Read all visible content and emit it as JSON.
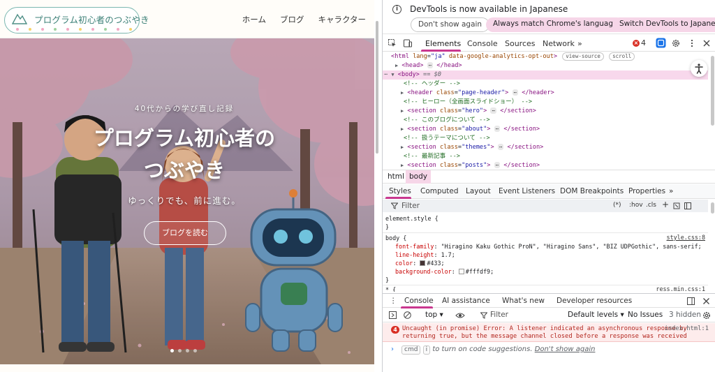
{
  "site": {
    "logo_title": "プログラム初心者のつぶやき",
    "nav": [
      "ホーム",
      "ブログ",
      "キャラクター"
    ],
    "hero": {
      "subtitle": "40代からの学び直し記録",
      "title_line1": "プログラム初心者の",
      "title_line2": "つぶやき",
      "tagline": "ゆっくりでも、前に進む。",
      "cta": "ブログを読む",
      "dots": 4,
      "active_dot": 0
    }
  },
  "devtools": {
    "infobar": {
      "message": "DevTools is now available in Japanese",
      "btn_dont_show": "Don't show again",
      "btn_match": "Always match Chrome's language",
      "btn_switch": "Switch DevTools to Japanese"
    },
    "tabs": [
      "Elements",
      "Console",
      "Sources",
      "Network"
    ],
    "more_tabs": "»",
    "error_count": "4",
    "dom": {
      "l1_tag": "html",
      "l1_attr1": "lang",
      "l1_val1": "\"ja\"",
      "l1_attr2": "data-google-analytics-opt-out",
      "l1_pill1": "view-source",
      "l1_pill2": "scroll",
      "l2": "head",
      "l2_close": "</head>",
      "l3_tag": "body",
      "l3_eq": "== $0",
      "c1": "<!-- ヘッダー -->",
      "h_tag": "header",
      "h_class": "\"page-header\"",
      "h_close": "</header>",
      "c2": "<!-- ヒーロー（全画面スライドショー） -->",
      "s1_class": "\"hero\"",
      "c3": "<!-- このブログについて -->",
      "s2_class": "\"about\"",
      "c4": "<!-- 扱うテーマについて -->",
      "s3_class": "\"themes\"",
      "c5": "<!-- 最新記事 -->",
      "s4_class": "\"posts\"",
      "section": "section",
      "section_close": "</section>",
      "class_attr": "class",
      "ellipsis": "⋯"
    },
    "breadcrumb": [
      "html",
      "body"
    ],
    "style_tabs": [
      "Styles",
      "Computed",
      "Layout",
      "Event Listeners",
      "DOM Breakpoints",
      "Properties"
    ],
    "filter": {
      "placeholder": "Filter",
      "hov": ":hov",
      "cls": ".cls",
      "pseudo": "(*)"
    },
    "styles": {
      "element_style": "element.style {",
      "close": "}",
      "body_sel": "body {",
      "body_src": "style.css:8",
      "ff_prop": "font-family",
      "ff_val": "\"Hiragino Kaku Gothic ProN\", \"Hiragino Sans\", \"BIZ UDPGothic\", sans-serif;",
      "lh_prop": "line-height",
      "lh_val": "1.7;",
      "color_prop": "color",
      "color_val": "#433;",
      "color_swatch": "#443333",
      "bg_prop": "background-color",
      "bg_val": "#fffdf9;",
      "bg_swatch": "#fffdf9",
      "star_sel": "* {",
      "star_src": "ress.min.css:1"
    },
    "console_tabs": [
      "Console",
      "AI assistance",
      "What's new",
      "Developer resources"
    ],
    "console_toolbar": {
      "context": "top",
      "filter": "Filter",
      "levels": "Default levels",
      "issues": "No Issues",
      "hidden": "3 hidden"
    },
    "error": {
      "count": "4",
      "line1": "Uncaught (in promise) Error: A listener indicated an asynchronous response by",
      "line2": "returning true, but the message channel closed before a response was received",
      "location": "index.html:1"
    },
    "prompt": {
      "kbd1": "cmd",
      "kbd2": "i",
      "text": "to turn on code suggestions.",
      "link": "Don't show again"
    },
    "accent": "#c9388f"
  }
}
